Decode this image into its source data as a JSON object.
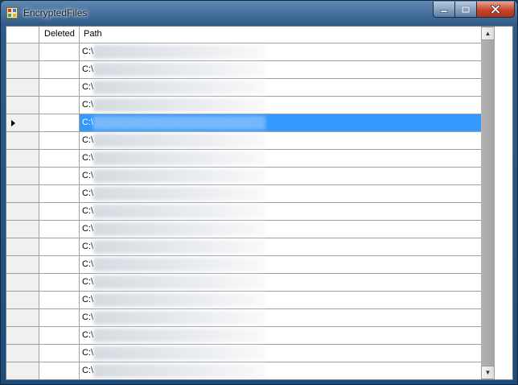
{
  "window": {
    "title": "EncryptedFiles",
    "controls": {
      "minimize": "minimize",
      "maximize": "maximize",
      "close": "close"
    }
  },
  "grid": {
    "columns": [
      {
        "label": ""
      },
      {
        "label": "Deleted"
      },
      {
        "label": "Path"
      }
    ],
    "selected_row_index": 4,
    "rows": [
      {
        "path": "C:\\"
      },
      {
        "path": "C:\\"
      },
      {
        "path": "C:\\"
      },
      {
        "path": "C:\\"
      },
      {
        "path": "C:\\"
      },
      {
        "path": "C:\\"
      },
      {
        "path": "C:\\"
      },
      {
        "path": "C:\\"
      },
      {
        "path": "C:\\"
      },
      {
        "path": "C:\\"
      },
      {
        "path": "C:\\"
      },
      {
        "path": "C:\\"
      },
      {
        "path": "C:\\"
      },
      {
        "path": "C:\\"
      },
      {
        "path": "C:\\"
      },
      {
        "path": "C:\\"
      },
      {
        "path": "C:\\"
      },
      {
        "path": "C:\\"
      },
      {
        "path": "C:\\"
      },
      {
        "path": "C:\\"
      }
    ]
  },
  "scrollbar": {
    "up": "▲",
    "down": "▼"
  },
  "colors": {
    "selection": "#3399ff",
    "grid_lines": "#a0a0a0",
    "row_header": "#f0f0f0"
  }
}
